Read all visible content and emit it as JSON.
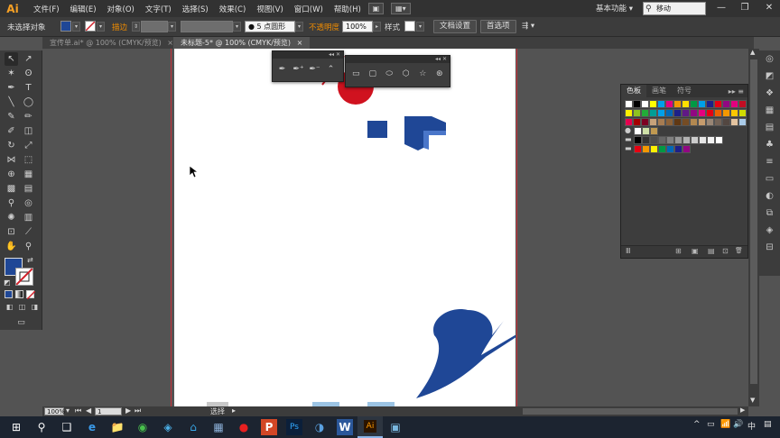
{
  "app": {
    "logo": "Ai"
  },
  "menubar": {
    "items": [
      "文件(F)",
      "编辑(E)",
      "对象(O)",
      "文字(T)",
      "选择(S)",
      "效果(C)",
      "视图(V)",
      "窗口(W)",
      "帮助(H)"
    ],
    "workspace_label": "基本功能",
    "workspace_arrow": "▾",
    "search_value": "移动",
    "search_icon": "⚲",
    "window_controls": [
      "—",
      "❐",
      "✕"
    ]
  },
  "controlbar": {
    "selection_status": "未选择对象",
    "stroke_label": "描边",
    "stroke_profile": "5 点圆形",
    "opacity_label": "不透明度",
    "opacity_value": "100%",
    "style_label": "样式",
    "doc_setup_button": "文档设置",
    "prefs_button": "首选项",
    "fill_color": "#1f4796"
  },
  "tabs": [
    {
      "label": "宣传单.ai* @ 100% (CMYK/预览)",
      "close": "×"
    },
    {
      "label": "未标题-5* @ 100% (CMYK/预览)",
      "close": "×"
    }
  ],
  "swatches": {
    "tabs": [
      "色板",
      "画笔",
      "符号"
    ],
    "footer_icons": [
      "Ⅲ",
      "⊞",
      "▣",
      "▤",
      "⊡",
      "🗑"
    ]
  },
  "statusbar": {
    "zoom": "100%",
    "page": "1",
    "mode": "选择"
  },
  "taskbar": {
    "icons": [
      "⊞",
      "⚲",
      "❑",
      "e",
      "📁",
      "◉",
      "◈",
      "⌂",
      "▦",
      "●",
      "P",
      "Ps",
      "◑",
      "W",
      "Ai",
      "▣"
    ],
    "tray": [
      "^",
      "▭",
      "📶",
      "🔊",
      "中",
      "▤"
    ]
  }
}
